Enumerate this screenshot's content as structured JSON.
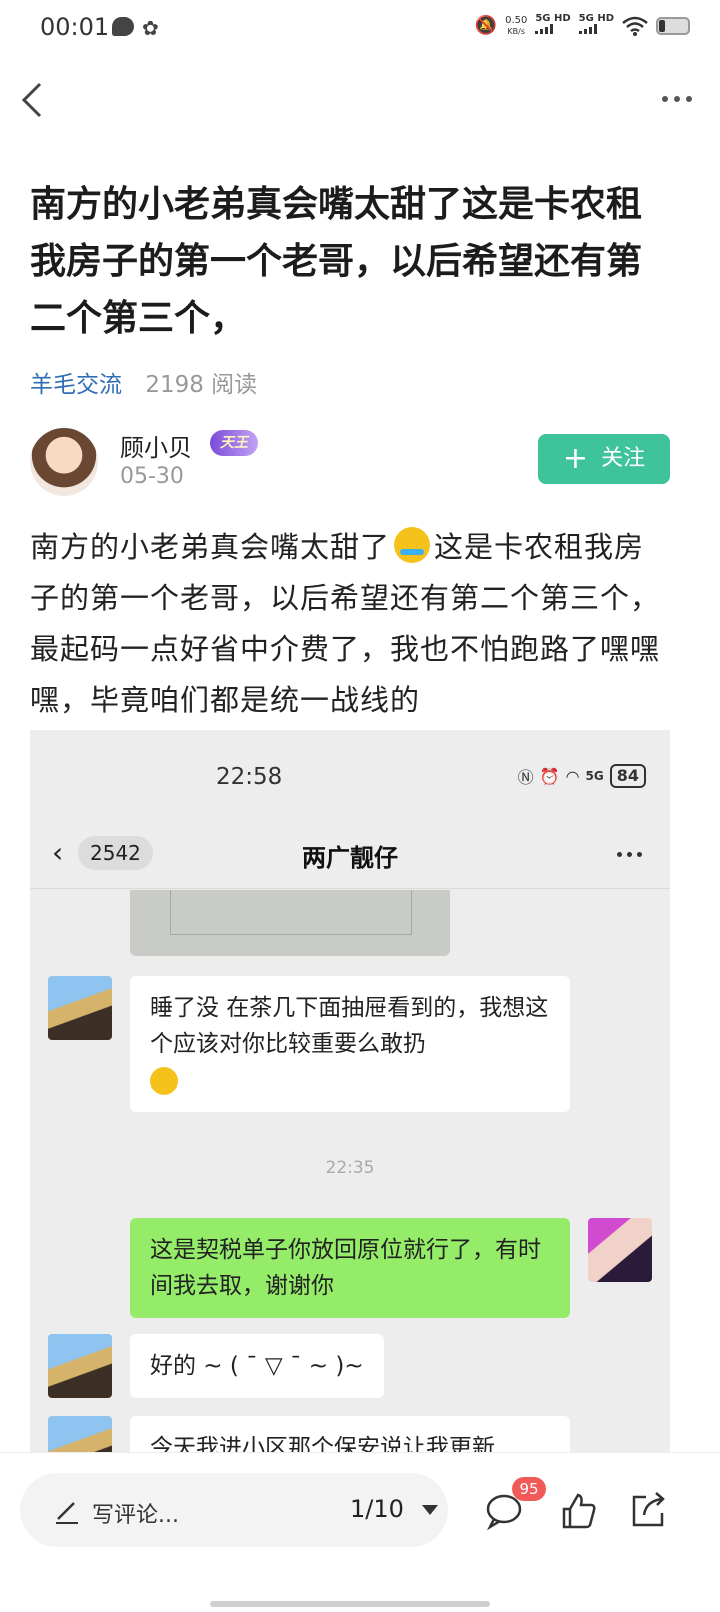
{
  "status_bar": {
    "time": "00:01",
    "net_speed": "0.50",
    "net_unit": "KB/s",
    "sig1": "5G HD",
    "sig2": "5G HD"
  },
  "article": {
    "title": "南方的小老弟真会嘴太甜了这是卡农租我房子的第一个老哥，以后希望还有第二个第三个，",
    "category": "羊毛交流",
    "reads": "2198 阅读",
    "author": {
      "name": "顾小贝",
      "badge": "天王",
      "date": "05-30",
      "follow_label": "关注"
    },
    "body_before_emoji": "南方的小老弟真会嘴太甜了",
    "body_after_emoji": "这是卡农租我房子的第一个老哥，以后希望还有第二个第三个，最起码一点好省中介费了，我也不怕跑路了嘿嘿嘿，毕竟咱们都是统一战线的"
  },
  "screenshot": {
    "time": "22:58",
    "battery": "84",
    "net": "5G",
    "back_count": "2542",
    "chat_title": "两广靓仔",
    "messages": [
      {
        "from": "other",
        "text": "睡了没 在茶几下面抽屉看到的，我想这个应该对你比较重要么敢扔"
      },
      {
        "from": "me",
        "text": "这是契税单子你放回原位就行了，有时间我去取，谢谢你"
      },
      {
        "from": "other",
        "text": "好的 ~ ( ¯ ▽ ¯ ~ )~"
      },
      {
        "from": "other",
        "text": "今天我进小区那个保安说让我更新"
      }
    ],
    "timestamp": "22:35"
  },
  "bottom_bar": {
    "comment_placeholder": "写评论...",
    "pager": "1/10",
    "comment_count": "95"
  }
}
